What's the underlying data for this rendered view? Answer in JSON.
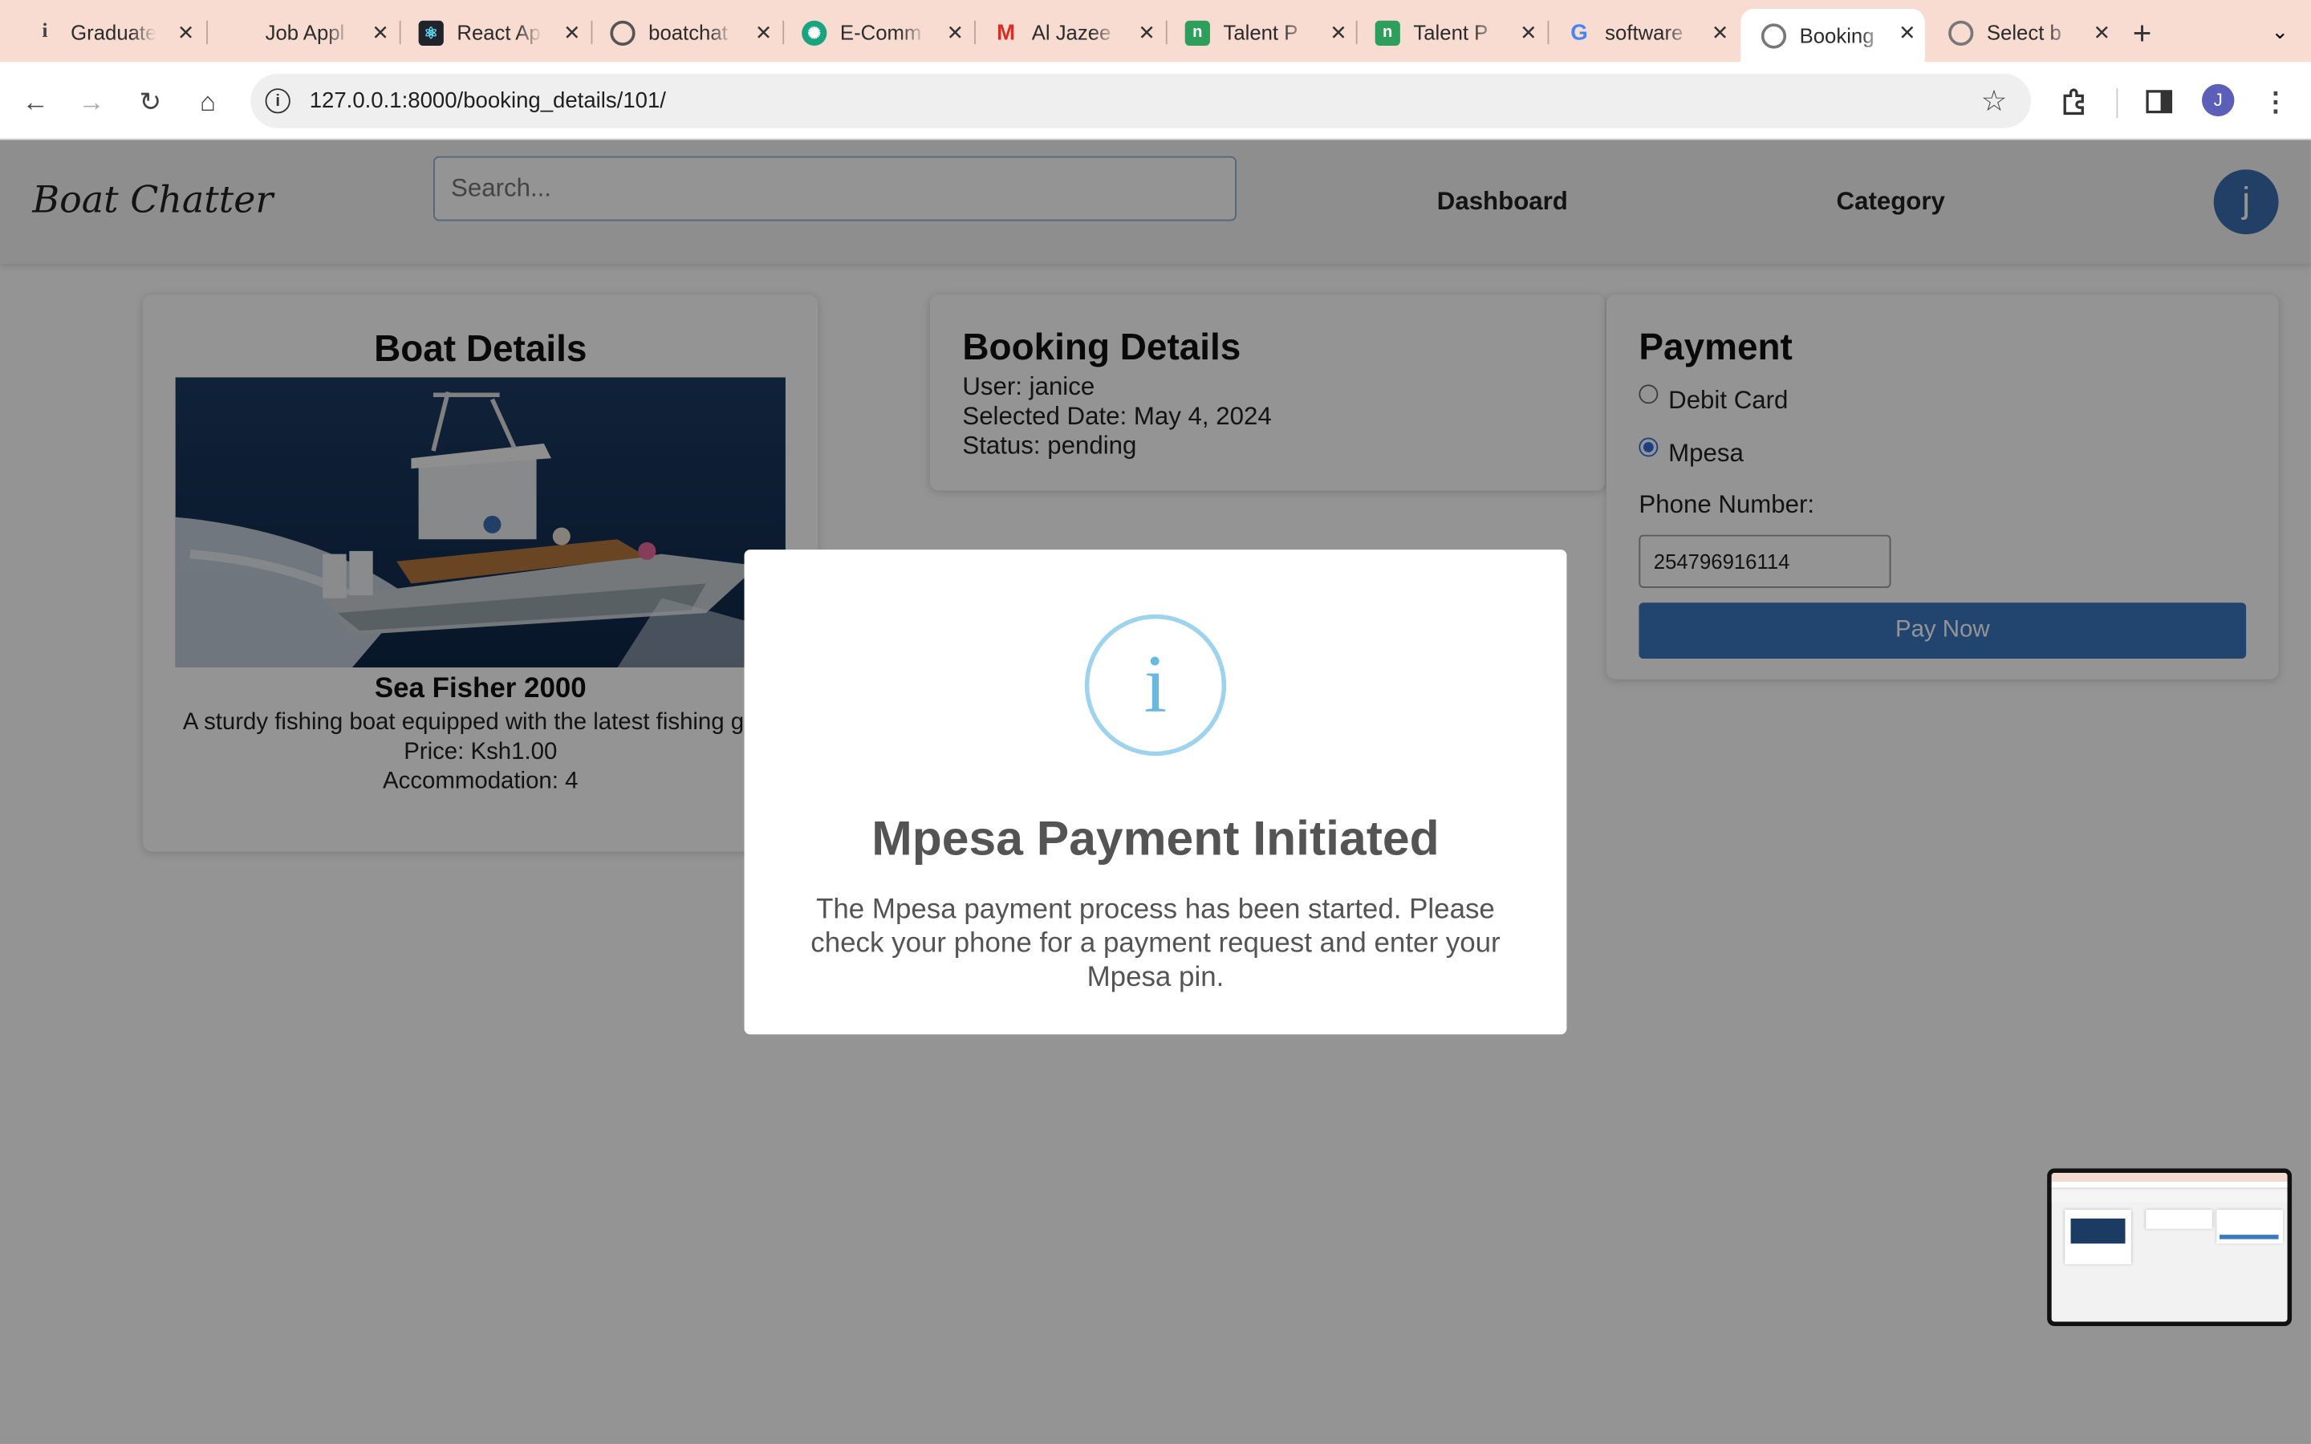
{
  "browser": {
    "tabs": [
      {
        "label": "Graduate",
        "icon": "info-icon"
      },
      {
        "label": "Job Appl",
        "icon": "blank-icon"
      },
      {
        "label": "React Ap",
        "icon": "react-icon"
      },
      {
        "label": "boatchat",
        "icon": "github-icon"
      },
      {
        "label": "E-Comm",
        "icon": "chatgpt-icon"
      },
      {
        "label": "Al Jazee",
        "icon": "gmail-icon"
      },
      {
        "label": "Talent P",
        "icon": "talent-icon"
      },
      {
        "label": "Talent P",
        "icon": "talent-icon"
      },
      {
        "label": "software",
        "icon": "google-icon"
      },
      {
        "label": "Booking",
        "icon": "globe-icon"
      },
      {
        "label": "Select b",
        "icon": "globe-icon"
      }
    ],
    "active_tab": "Booking",
    "url": "127.0.0.1:8000/booking_details/101/",
    "profile_initial": "J"
  },
  "navbar": {
    "brand": "Boat Chatter",
    "search_placeholder": "Search...",
    "links": [
      "Dashboard",
      "Category"
    ],
    "avatar_initial": "j"
  },
  "boat": {
    "heading": "Boat Details",
    "name": "Sea Fisher 2000",
    "description": "A sturdy fishing boat equipped with the latest fishing gear",
    "price": "Price: Ksh1.00",
    "accommodation": "Accommodation: 4"
  },
  "booking": {
    "heading": "Booking Details",
    "user": "User: janice",
    "date": "Selected Date: May 4, 2024",
    "status": "Status: pending"
  },
  "payment": {
    "heading": "Payment",
    "options": [
      {
        "label": "Debit Card",
        "selected": false
      },
      {
        "label": "Mpesa",
        "selected": true
      }
    ],
    "phone_label": "Phone Number:",
    "phone_value": "254796916114",
    "pay_button": "Pay Now",
    "button_color": "#3b78c2"
  },
  "modal": {
    "icon": "info-icon",
    "title": "Mpesa Payment Initiated",
    "message": "The Mpesa payment process has been started. Please check your phone for a payment request and enter your Mpesa pin."
  }
}
